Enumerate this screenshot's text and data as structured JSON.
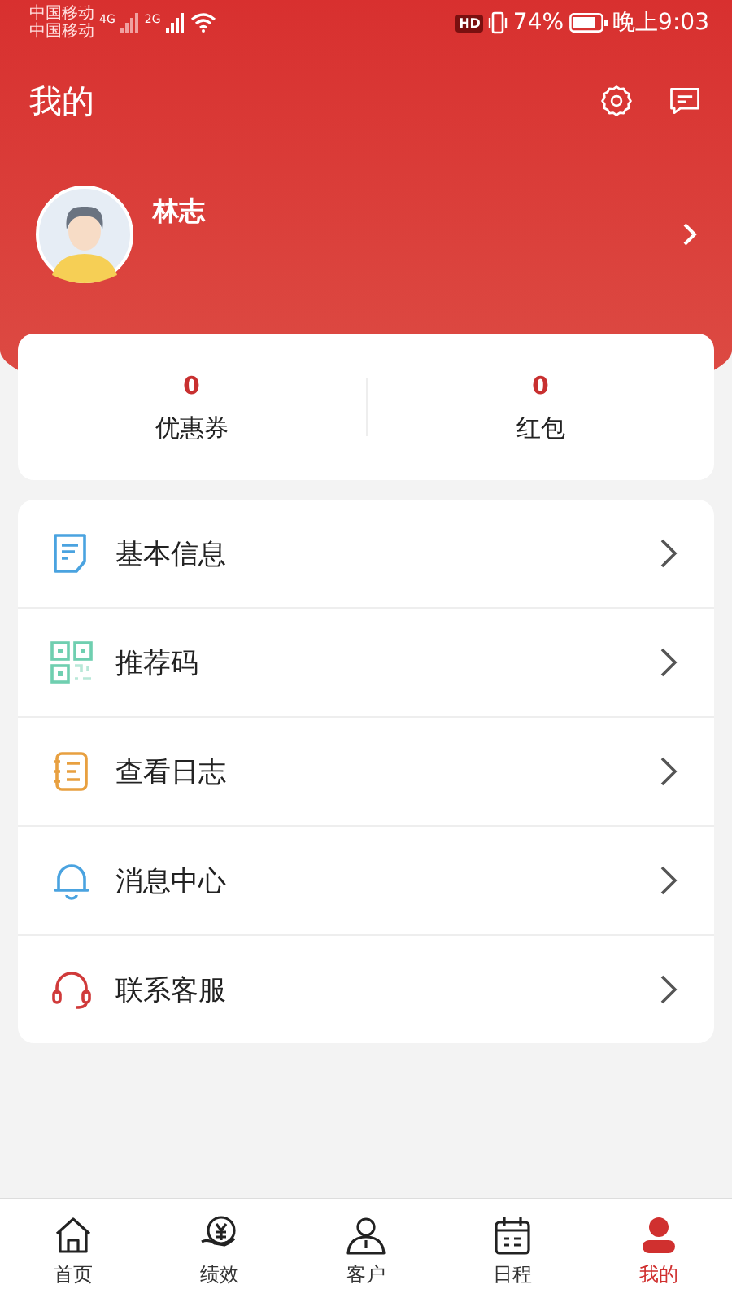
{
  "status_bar": {
    "carriers": [
      "中国移动",
      "中国移动"
    ],
    "network_labels": [
      "4G",
      "2G"
    ],
    "hd": "HD",
    "battery_text": "74%",
    "time": "晚上9:03"
  },
  "header": {
    "title": "我的"
  },
  "profile": {
    "name": "林志"
  },
  "stats": [
    {
      "value": "0",
      "label": "优惠券"
    },
    {
      "value": "0",
      "label": "红包"
    }
  ],
  "menu": [
    {
      "kind": "doc",
      "label": "基本信息"
    },
    {
      "kind": "qr",
      "label": "推荐码"
    },
    {
      "kind": "log",
      "label": "查看日志"
    },
    {
      "kind": "bell",
      "label": "消息中心"
    },
    {
      "kind": "headset",
      "label": "联系客服"
    }
  ],
  "tabs": [
    {
      "kind": "home",
      "label": "首页",
      "selected": false
    },
    {
      "kind": "money",
      "label": "绩效",
      "selected": false
    },
    {
      "kind": "user",
      "label": "客户",
      "selected": false
    },
    {
      "kind": "calendar",
      "label": "日程",
      "selected": false
    },
    {
      "kind": "profile",
      "label": "我的",
      "selected": true
    }
  ]
}
